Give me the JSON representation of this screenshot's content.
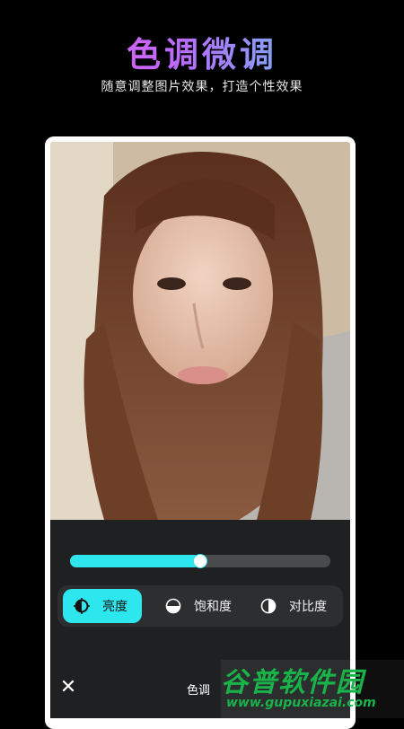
{
  "header": {
    "title": "色调微调",
    "subtitle": "随意调整图片效果，打造个性效果"
  },
  "editor": {
    "slider": {
      "value_percent": 50
    },
    "tabs": [
      {
        "label": "亮度",
        "icon": "brightness-icon",
        "active": true
      },
      {
        "label": "饱和度",
        "icon": "saturation-icon",
        "active": false
      },
      {
        "label": "对比度",
        "icon": "contrast-icon",
        "active": false
      }
    ],
    "bottom": {
      "close_glyph": "✕",
      "mode_label": "色调"
    }
  },
  "watermark": {
    "title": "谷普软件园",
    "url": "www.gupuxiazai.com"
  },
  "colors": {
    "accent": "#2ee6ee",
    "panel": "#1f2021",
    "tabbar": "#2d2e30",
    "watermark": "#19b34a"
  }
}
